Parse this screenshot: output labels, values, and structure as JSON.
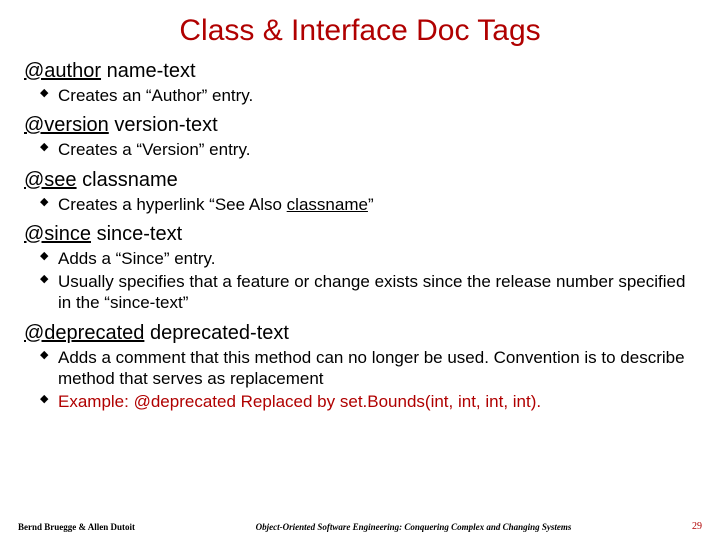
{
  "title": "Class & Interface Doc Tags",
  "tags": {
    "author": {
      "name": "@author",
      "param": "name-text",
      "bullets": [
        "Creates an “Author” entry."
      ]
    },
    "version": {
      "name": "@version",
      "param": "version-text",
      "bullets": [
        "Creates a “Version” entry."
      ]
    },
    "see": {
      "name": "@see",
      "param": "classname",
      "bullet_prefix": "Creates a hyperlink “See Also ",
      "bullet_link": "classname",
      "bullet_suffix": "”"
    },
    "since": {
      "name": "@since",
      "param": "since-text",
      "bullets": [
        "Adds a “Since” entry.",
        "Usually specifies that a feature or change exists since the release number specified in the “since-text”"
      ]
    },
    "deprecated": {
      "name": "@deprecated",
      "param": "deprecated-text",
      "bullets": [
        "Adds a comment that this method can no longer be used. Convention is to describe method that serves as replacement"
      ],
      "example": "Example: @deprecated  Replaced by set.Bounds(int, int, int, int)."
    }
  },
  "footer": {
    "left": "Bernd Bruegge & Allen Dutoit",
    "center": "Object-Oriented Software Engineering: Conquering Complex and Changing Systems",
    "right": "29"
  }
}
